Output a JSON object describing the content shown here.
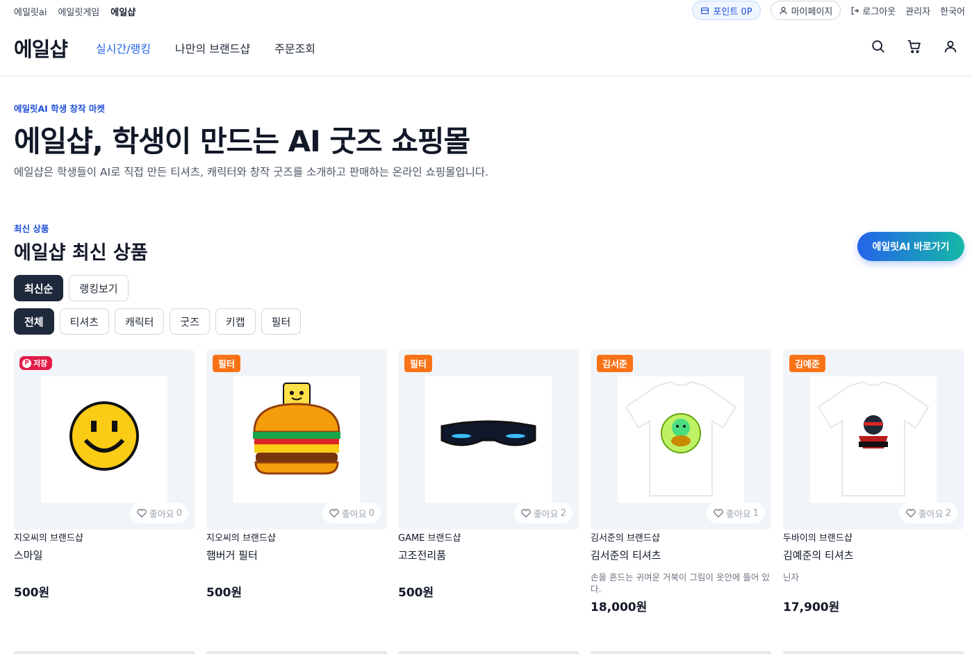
{
  "topbar": {
    "left_links": [
      "에일릿ai",
      "에일릿게임",
      "에일샵"
    ],
    "points_label": "포인트 0P",
    "mypage_label": "마이페이지",
    "logout_label": "로그아웃",
    "admin_label": "관리자",
    "language_label": "한국어"
  },
  "nav": {
    "logo": "에일샵",
    "menu": [
      "실시간/랭킹",
      "나만의 브랜드샵",
      "주문조회"
    ]
  },
  "hero": {
    "eyebrow": "에일릿AI 학생 창작 마켓",
    "title": "에일샵, 학생이 만드는 AI 굿즈 쇼핑몰",
    "description": "에일샵은 학생들이 AI로 직접 만든 티셔츠, 캐릭터와 창작 굿즈를 소개하고 판매하는 온라인 쇼핑몰입니다."
  },
  "section": {
    "eyebrow": "최신 상품",
    "title": "에일샵 최신 상품",
    "cta_label": "에일릿AI 바로가기",
    "sort_buttons": [
      "최신순",
      "랭킹보기"
    ],
    "category_filters": [
      "전체",
      "티셔츠",
      "캐릭터",
      "굿즈",
      "키캡",
      "필터"
    ]
  },
  "products": [
    {
      "badge": "저장",
      "brand": "지오씨의 브랜드샵",
      "name": "스마일",
      "desc": "",
      "price": "500원",
      "like_label": "좋아요",
      "likes": "0",
      "image": "smiley-icon"
    },
    {
      "badge": "필터",
      "brand": "지오씨의 브랜드샵",
      "name": "햄버거 필터",
      "desc": "",
      "price": "500원",
      "like_label": "좋아요",
      "likes": "0",
      "image": "hamburger-icon"
    },
    {
      "badge": "필터",
      "brand": "GAME 브랜드샵",
      "name": "고조전리품",
      "desc": "",
      "price": "500원",
      "like_label": "좋아요",
      "likes": "2",
      "image": "goggles-icon"
    },
    {
      "badge": "김서준",
      "brand": "김서준의 브랜드샵",
      "name": "김서준의 티셔츠",
      "desc": "손을 흔드는 귀여운 거북이 그림이 옷안에 들어 있다.",
      "price": "18,000원",
      "like_label": "좋아요",
      "likes": "1",
      "image": "turtle-tshirt"
    },
    {
      "badge": "김예준",
      "brand": "두바이의 브랜드샵",
      "name": "김예준의 티셔츠",
      "desc": "닌자",
      "price": "17,900원",
      "like_label": "좋아요",
      "likes": "2",
      "image": "ninja-tshirt"
    }
  ],
  "colors": {
    "accent": "#2563eb",
    "badge": "#f97316",
    "dark_button": "#1e293b"
  }
}
